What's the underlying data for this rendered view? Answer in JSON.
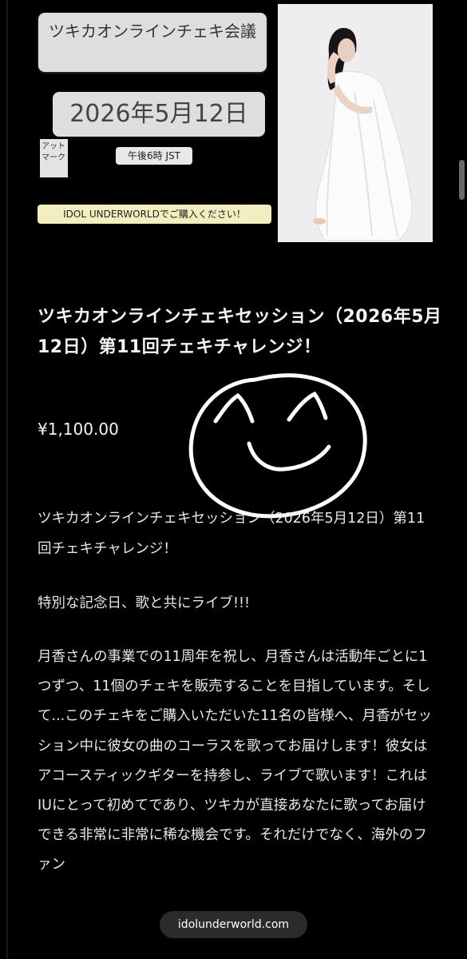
{
  "banner": {
    "title": "ツキカオンラインチェキ会議",
    "date": "2026年5月12日",
    "at_mark": "アットマーク",
    "time": "午後6時 JST",
    "buy_notice": "IDOL UNDERWORLDでご購入ください！"
  },
  "product": {
    "title": "ツキカオンラインチェキセッション（2026年5月12日）第11回チェキチャレンジ！",
    "price": "¥1,100.00"
  },
  "description": {
    "p1": "ツキカオンラインチェキセッション（2026年5月12日）第11回チェキチャレンジ！",
    "p2": "特別な記念日、歌と共にライブ!!!",
    "p3": "月香さんの事業での11周年を祝し、月香さんは活動年ごとに1つずつ、11個のチェキを販売することを目指しています。そして...このチェキをご購入いただいた11名の皆様へ、月香がセッション中に彼女の曲のコーラスを歌ってお届けします！彼女はアコースティックギターを持参し、ライブで歌います！これはIUにとって初めてであり、ツキカが直接あなたに歌ってお届けできる非常に非常に稀な機会です。それだけでなく、海外のファン"
  },
  "browser": {
    "url": "idolunderworld.com"
  },
  "colors": {
    "background": "#000000",
    "label_bg": "#dedede",
    "notice_bg": "#f2eec0"
  },
  "icons": [
    "smiley-drawing-icon"
  ]
}
